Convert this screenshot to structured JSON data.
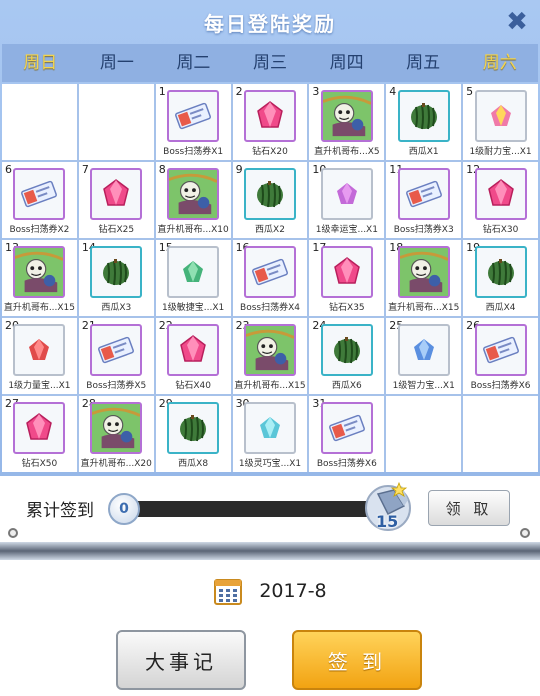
{
  "title": "每日登陆奖励",
  "weekdays": [
    "周日",
    "周一",
    "周二",
    "周三",
    "周四",
    "周五",
    "周六"
  ],
  "cells": [
    {
      "day": "",
      "label": "",
      "item": "empty"
    },
    {
      "day": "",
      "label": "",
      "item": "empty"
    },
    {
      "day": "1",
      "label": "Boss扫荡券X1",
      "item": "ticket"
    },
    {
      "day": "2",
      "label": "钻石X20",
      "item": "diamond"
    },
    {
      "day": "3",
      "label": "直升机哥布...X5",
      "item": "goblin"
    },
    {
      "day": "4",
      "label": "西瓜X1",
      "item": "watermelon"
    },
    {
      "day": "5",
      "label": "1级耐力宝...X1",
      "item": "gem-yellow"
    },
    {
      "day": "6",
      "label": "Boss扫荡券X2",
      "item": "ticket"
    },
    {
      "day": "7",
      "label": "钻石X25",
      "item": "diamond"
    },
    {
      "day": "8",
      "label": "直升机哥布...X10",
      "item": "goblin"
    },
    {
      "day": "9",
      "label": "西瓜X2",
      "item": "watermelon"
    },
    {
      "day": "10",
      "label": "1级幸运宝...X1",
      "item": "gem-pink"
    },
    {
      "day": "11",
      "label": "Boss扫荡券X3",
      "item": "ticket"
    },
    {
      "day": "12",
      "label": "钻石X30",
      "item": "diamond"
    },
    {
      "day": "13",
      "label": "直升机哥布...X15",
      "item": "goblin"
    },
    {
      "day": "14",
      "label": "西瓜X3",
      "item": "watermelon"
    },
    {
      "day": "15",
      "label": "1级敏捷宝...X1",
      "item": "gem-green"
    },
    {
      "day": "16",
      "label": "Boss扫荡券X4",
      "item": "ticket"
    },
    {
      "day": "17",
      "label": "钻石X35",
      "item": "diamond"
    },
    {
      "day": "18",
      "label": "直升机哥布...X15",
      "item": "goblin"
    },
    {
      "day": "19",
      "label": "西瓜X4",
      "item": "watermelon"
    },
    {
      "day": "20",
      "label": "1级力量宝...X1",
      "item": "gem-red"
    },
    {
      "day": "21",
      "label": "Boss扫荡券X5",
      "item": "ticket"
    },
    {
      "day": "22",
      "label": "钻石X40",
      "item": "diamond"
    },
    {
      "day": "23",
      "label": "直升机哥布...X15",
      "item": "goblin"
    },
    {
      "day": "24",
      "label": "西瓜X6",
      "item": "watermelon"
    },
    {
      "day": "25",
      "label": "1级智力宝...X1",
      "item": "gem-blue"
    },
    {
      "day": "26",
      "label": "Boss扫荡券X6",
      "item": "ticket"
    },
    {
      "day": "27",
      "label": "钻石X50",
      "item": "diamond"
    },
    {
      "day": "28",
      "label": "直升机哥布...X20",
      "item": "goblin"
    },
    {
      "day": "29",
      "label": "西瓜X8",
      "item": "watermelon"
    },
    {
      "day": "30",
      "label": "1级灵巧宝...X1",
      "item": "gem-cyan"
    },
    {
      "day": "31",
      "label": "Boss扫荡券X6",
      "item": "ticket"
    },
    {
      "day": "",
      "label": "",
      "item": "empty"
    },
    {
      "day": "",
      "label": "",
      "item": "empty"
    }
  ],
  "progress": {
    "label": "累计签到",
    "current": "0",
    "goal": "15",
    "claim_label": "领 取"
  },
  "date": "2017-8",
  "buttons": {
    "events": "大事记",
    "checkin": "签 到"
  },
  "colors": {
    "weekend": "#f2d44e",
    "checkin_button": "#f5b020"
  },
  "icons": [
    "close-icon",
    "calendar-icon",
    "ticket-icon",
    "diamond-icon",
    "goblin-icon",
    "watermelon-icon",
    "gem-icon"
  ]
}
